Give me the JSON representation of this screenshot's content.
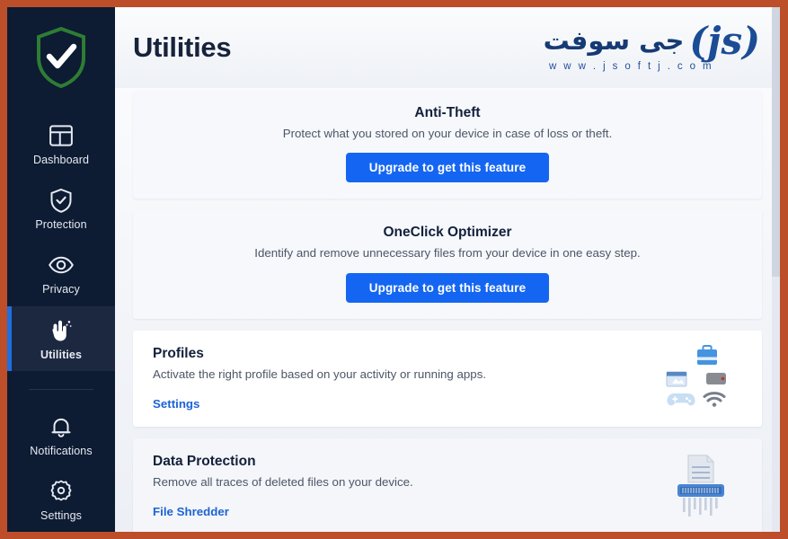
{
  "window": {
    "frame_color": "#bd4e2a",
    "app_background": "#eef1f7"
  },
  "sidebar": {
    "background": "#0d1b33",
    "accent_color": "#1f6fe0",
    "logo": {
      "icon": "shield-check-icon",
      "shield_color": "#2e7d32",
      "check_color": "#ffffff"
    },
    "items": [
      {
        "label": "Dashboard",
        "icon": "dashboard-layout-icon",
        "active": false
      },
      {
        "label": "Protection",
        "icon": "shield-check-icon",
        "active": false
      },
      {
        "label": "Privacy",
        "icon": "eye-icon",
        "active": false
      },
      {
        "label": "Utilities",
        "icon": "hand-tools-icon",
        "active": true
      }
    ],
    "bottom_items": [
      {
        "label": "Notifications",
        "icon": "bell-icon",
        "active": false
      },
      {
        "label": "Settings",
        "icon": "gear-icon",
        "active": false
      }
    ]
  },
  "header": {
    "title": "Utilities",
    "watermark": {
      "arabic": "جی سوفت",
      "mark": "(js)",
      "url": "w w w . j s o f t j . c o m",
      "color": "#1b4c96"
    }
  },
  "main": {
    "cards": [
      {
        "id": "anti-theft",
        "style": "promo",
        "title": "Anti-Theft",
        "description": "Protect what you stored on your device in case of loss or theft.",
        "button": "Upgrade to get this feature",
        "button_color": "#1466f2"
      },
      {
        "id": "oneclick-optimizer",
        "style": "promo",
        "title": "OneClick Optimizer",
        "description": "Identify and remove unnecessary files from your device in one easy step.",
        "button": "Upgrade to get this feature",
        "button_color": "#1466f2"
      },
      {
        "id": "profiles",
        "style": "plain",
        "title": "Profiles",
        "description": "Activate the right profile based on your activity or running apps.",
        "link": "Settings",
        "link_color": "#1d63d4",
        "art": "profiles-icons"
      },
      {
        "id": "data-protection",
        "style": "plain-tinted",
        "title": "Data Protection",
        "description": "Remove all traces of deleted files on your device.",
        "link": "File Shredder",
        "link_color": "#1d63d4",
        "art": "paper-shredder-icon"
      }
    ]
  }
}
